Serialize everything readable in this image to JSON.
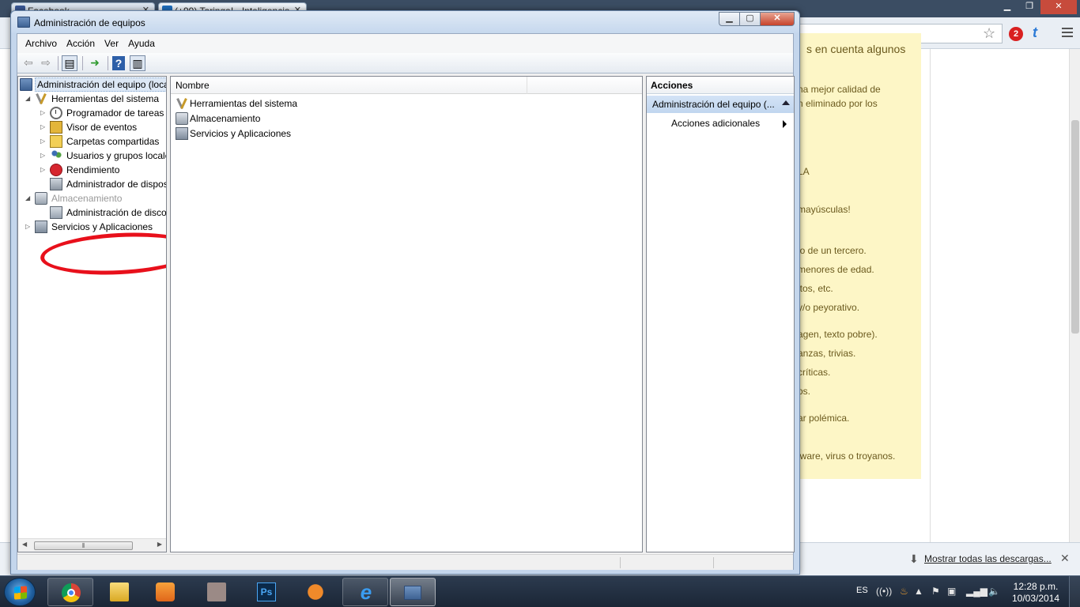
{
  "browser": {
    "tabs": [
      {
        "label": "Facebook"
      },
      {
        "label": "(+99) Taringa! - Inteligencia"
      }
    ],
    "downloads": {
      "show_all": "Mostrar todas las descargas..."
    },
    "ext_badge": "2",
    "page": {
      "heading": "s en cuenta algunos",
      "rules": [
        "na mejor calidad de",
        "n eliminado por los",
        "LA",
        "mayúsculas!",
        "io de un tercero.",
        "menores de edad.",
        "itos, etc.",
        "y/o peyorativo.",
        "agen, texto pobre).",
        "anzas, trivias.",
        "críticas.",
        "os.",
        "ar polémica.",
        "lware, virus o troyanos."
      ]
    }
  },
  "window": {
    "title": "Administración de equipos",
    "menu": [
      "Archivo",
      "Acción",
      "Ver",
      "Ayuda"
    ],
    "tree": {
      "root": "Administración del equipo (local)",
      "system_tools": "Herramientas del sistema",
      "task_scheduler": "Programador de tareas",
      "event_viewer": "Visor de eventos",
      "shared_folders": "Carpetas compartidas",
      "local_users": "Usuarios y grupos locales",
      "performance": "Rendimiento",
      "device_manager": "Administrador de dispositivos",
      "storage": "Almacenamiento",
      "disk_management": "Administración de discos",
      "services_apps": "Servicios y Aplicaciones"
    },
    "list": {
      "column_name": "Nombre",
      "items": [
        "Herramientas del sistema",
        "Almacenamiento",
        "Servicios y Aplicaciones"
      ]
    },
    "actions": {
      "header": "Acciones",
      "section": "Administración del equipo (...",
      "item": "Acciones adicionales"
    }
  },
  "taskbar": {
    "language": "ES",
    "time": "12:28 p.m.",
    "date": "10/03/2014"
  }
}
